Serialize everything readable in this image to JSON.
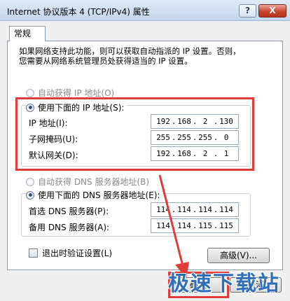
{
  "window": {
    "title": "Internet 协议版本 4 (TCP/IPv4) 属性",
    "help_label": "?",
    "close_label": "X"
  },
  "tab": {
    "label": "常规"
  },
  "description": {
    "line1": "如果网络支持此功能，则可以获取自动指派的 IP 设置。否则，",
    "line2": "您需要从网络系统管理员处获得适当的 IP 设置。"
  },
  "ip_section": {
    "auto_label": "自动获得 IP 地址(O)",
    "manual_label": "使用下面的 IP 地址(S):",
    "fields": [
      {
        "label": "IP 地址(I):",
        "value": [
          "192",
          "168",
          "2",
          "130"
        ]
      },
      {
        "label": "子网掩码(U):",
        "value": [
          "255",
          "255",
          "255",
          "0"
        ]
      },
      {
        "label": "默认网关(D):",
        "value": [
          "192",
          "168",
          "2",
          "1"
        ]
      }
    ]
  },
  "dns_section": {
    "auto_label": "自动获得 DNS 服务器地址(B)",
    "manual_label": "使用下面的 DNS 服务器地址(E):",
    "fields": [
      {
        "label": "首选 DNS 服务器(P):",
        "value": [
          "114",
          "114",
          "114",
          "114"
        ]
      },
      {
        "label": "备用 DNS 服务器(A):",
        "value": [
          "114",
          "114",
          "115",
          "115"
        ]
      }
    ]
  },
  "validate_label": "退出时验证设置(L)",
  "advanced_label": "高级(V)...",
  "ok_label": "确定",
  "cancel_label": "取消",
  "watermark": "极速下载站",
  "colors": {
    "annotation": "#e03c3c",
    "watermark": "#2f6eb8"
  }
}
